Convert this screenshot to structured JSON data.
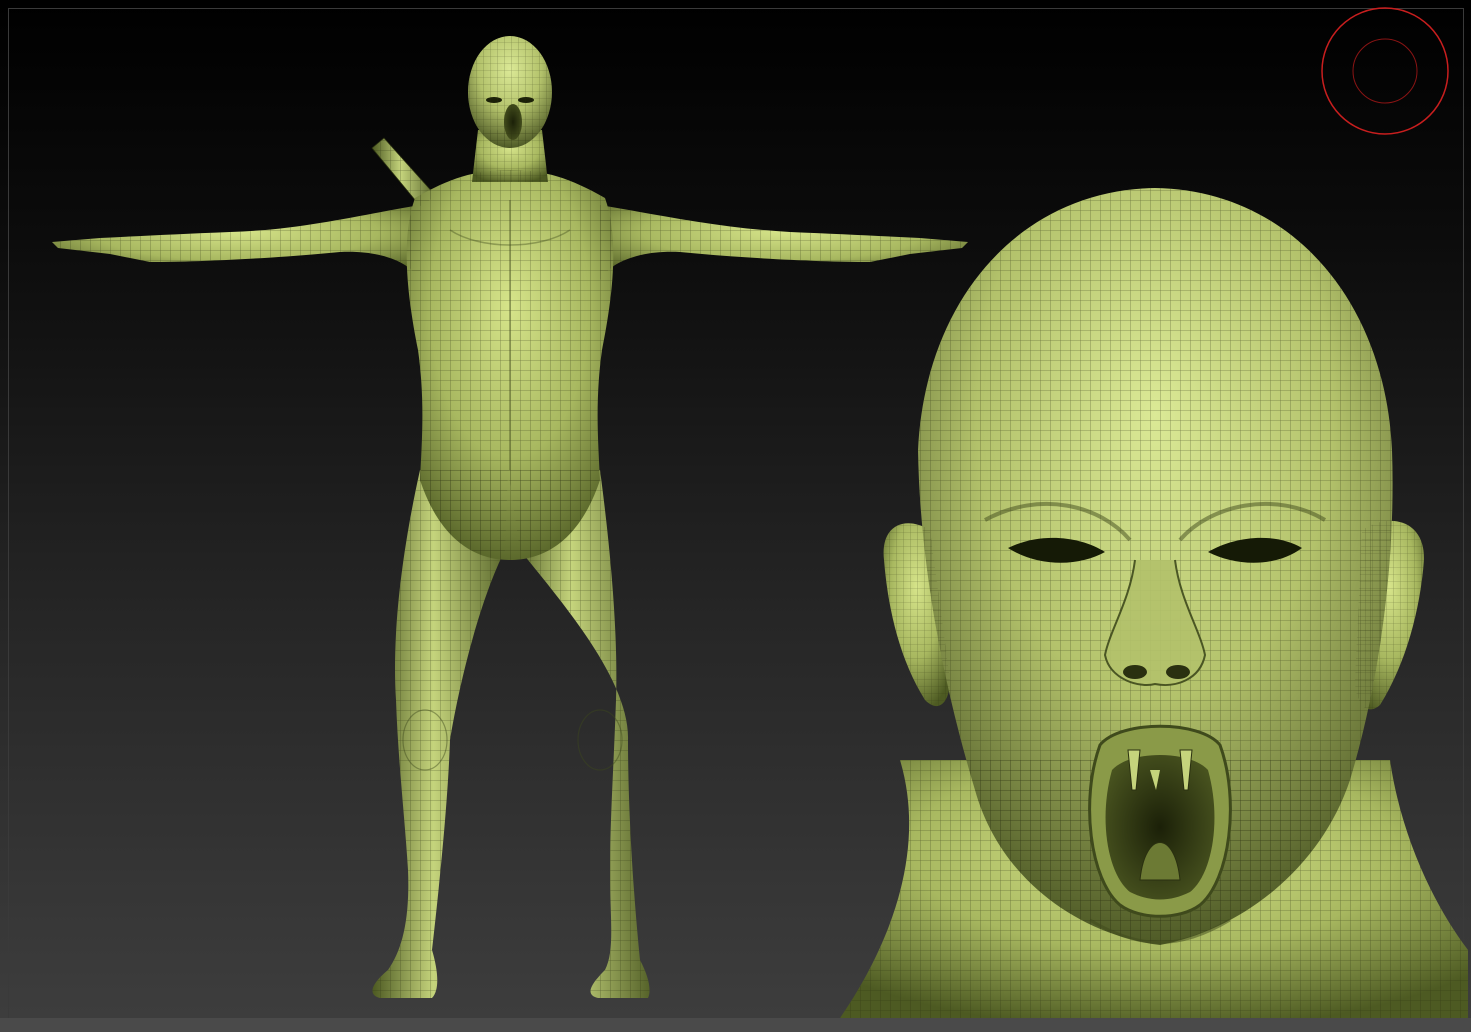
{
  "viewport": {
    "background_top": "#000000",
    "background_bottom": "#3e3e3e"
  },
  "model": {
    "base_color": "#a8b860",
    "highlight_color": "#d6e48a",
    "shadow_color": "#3f4a1c",
    "wire_color": "#2a3010"
  },
  "rotation_gizmo": {
    "icon": "rotation-gizmo-icon",
    "color": "#c81e1e"
  }
}
